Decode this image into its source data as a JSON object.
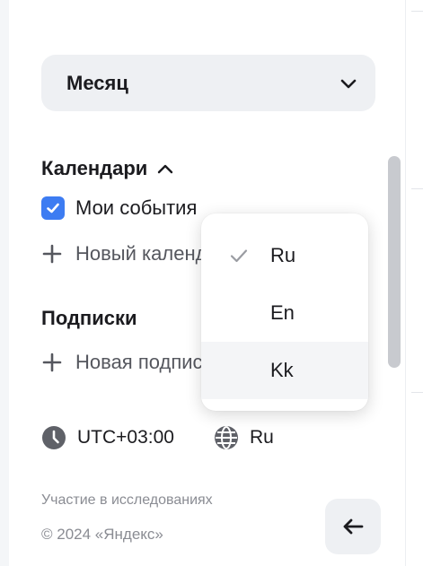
{
  "view_select": {
    "value": "Месяц",
    "icon": "chevron-down-icon"
  },
  "calendars": {
    "title": "Календари",
    "expanded": true,
    "items": [
      {
        "label": "Мои события",
        "checked": true
      }
    ],
    "add_label": "Новый календарь"
  },
  "subscriptions": {
    "title": "Подписки",
    "add_label": "Новая подписка"
  },
  "footer": {
    "timezone": "UTC+03:00",
    "language": "Ru",
    "research_link": "Участие в исследованиях",
    "copyright": "© 2024 «Яндекс»"
  },
  "language_menu": {
    "options": [
      {
        "label": "Ru",
        "selected": true
      },
      {
        "label": "En",
        "selected": false
      },
      {
        "label": "Kk",
        "selected": false,
        "hovered": true
      }
    ]
  },
  "colors": {
    "accent": "#3d7cf2",
    "panel_bg": "#ffffff",
    "control_bg": "#eef0f3",
    "muted_text": "#8a8c93"
  }
}
